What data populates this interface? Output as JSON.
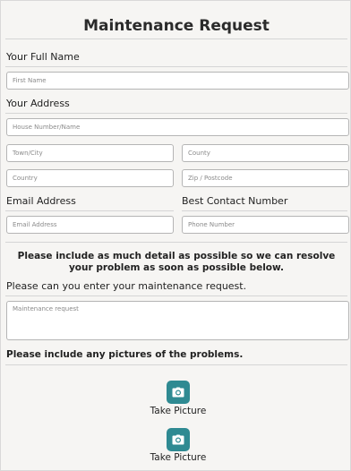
{
  "form": {
    "title": "Maintenance Request",
    "name_section": {
      "label": "Your Full Name",
      "first_name_placeholder": "First Name"
    },
    "address_section": {
      "label": "Your Address",
      "house_placeholder": "House Number/Name",
      "town_placeholder": "Town/City",
      "county_placeholder": "County",
      "country_placeholder": "Country",
      "zip_placeholder": "Zip / Postcode"
    },
    "contact_section": {
      "email_label": "Email Address",
      "email_placeholder": "Email Address",
      "phone_label": "Best Contact Number",
      "phone_placeholder": "Phone Number"
    },
    "notice": "Please include as much detail as possible so we can resolve your problem as soon as possible below.",
    "request_section": {
      "label": "Please can you enter your maintenance request.",
      "placeholder": "Maintenance request"
    },
    "pictures_section": {
      "heading": "Please include any pictures of the problems.",
      "buttons": [
        {
          "label": "Take Picture",
          "icon": "camera-icon"
        },
        {
          "label": "Take Picture",
          "icon": "camera-icon"
        }
      ]
    }
  },
  "colors": {
    "background": "#f6f5f3",
    "accent": "#2f8a92",
    "field_border": "#b5b5b5"
  }
}
